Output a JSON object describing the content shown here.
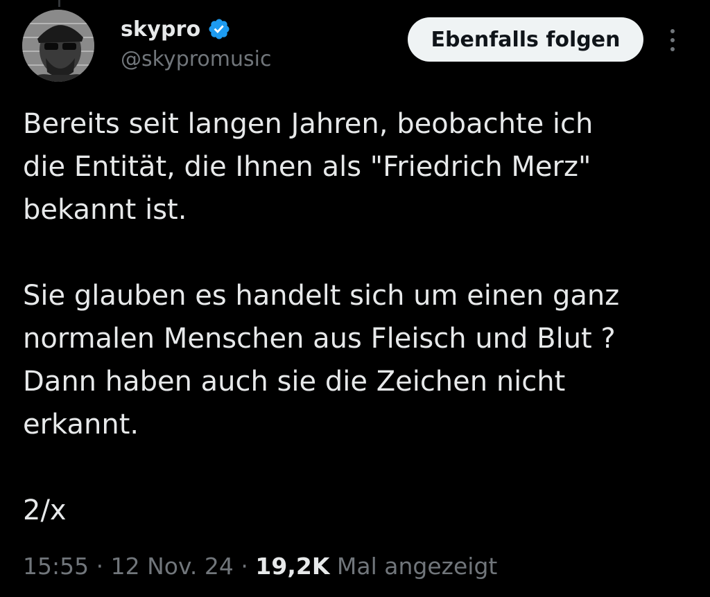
{
  "author": {
    "display_name": "skypro",
    "handle": "@skypromusic",
    "verified_color": "#1d9bf0",
    "verified_icon": "verified-badge-icon",
    "avatar_icon": "profile-photo"
  },
  "follow_button": {
    "label": "Ebenfalls folgen",
    "bg_color": "#eff3f4",
    "text_color": "#0f1419"
  },
  "more_icon": "more-vertical-icon",
  "tweet": {
    "paragraphs": [
      [
        "Bereits seit langen Jahren, beobachte ich",
        "die Entität, die Ihnen als \"Friedrich Merz\"",
        "bekannt ist."
      ],
      [
        "Sie glauben es handelt sich um einen ganz",
        "normalen Menschen aus Fleisch und Blut ?",
        "Dann haben auch sie die Zeichen nicht",
        "erkannt."
      ],
      [
        "2/x"
      ]
    ]
  },
  "meta": {
    "time": "15:55",
    "separator": "·",
    "date": "12 Nov. 24",
    "views_count": "19,2K",
    "views_label": "Mal angezeigt"
  },
  "colors": {
    "background": "#000000",
    "primary_text": "#e7e9ea",
    "secondary_text": "#71767b"
  }
}
